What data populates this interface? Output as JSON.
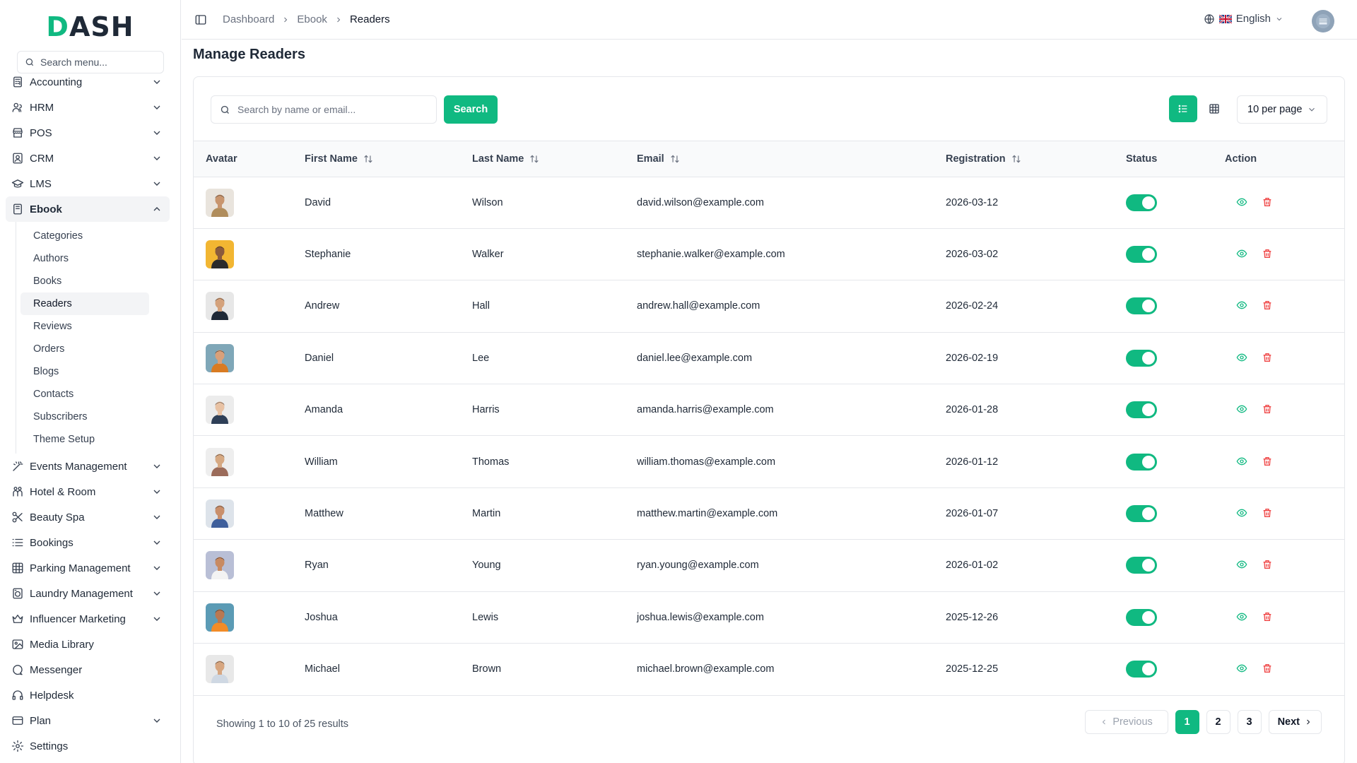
{
  "app": {
    "logo": "DASH"
  },
  "sidebar": {
    "search_placeholder": "Search menu...",
    "items": [
      {
        "label": "Accounting",
        "icon": "calculator-icon",
        "chevron": true
      },
      {
        "label": "HRM",
        "icon": "users-icon",
        "chevron": true
      },
      {
        "label": "POS",
        "icon": "store-icon",
        "chevron": true
      },
      {
        "label": "CRM",
        "icon": "contact-icon",
        "chevron": true
      },
      {
        "label": "LMS",
        "icon": "graduation-cap-icon",
        "chevron": true
      },
      {
        "label": "Ebook",
        "icon": "book-icon",
        "chevron": true,
        "active": true
      }
    ],
    "ebook_sub": [
      "Categories",
      "Authors",
      "Books",
      "Readers",
      "Reviews",
      "Orders",
      "Blogs",
      "Contacts",
      "Subscribers",
      "Theme Setup"
    ],
    "ebook_active": "Readers",
    "items_after": [
      {
        "label": "Events Management",
        "icon": "wand-icon",
        "chevron": true
      },
      {
        "label": "Hotel & Room",
        "icon": "hotel-icon",
        "chevron": true
      },
      {
        "label": "Beauty Spa",
        "icon": "scissors-icon",
        "chevron": true
      },
      {
        "label": "Bookings",
        "icon": "list-icon",
        "chevron": true
      },
      {
        "label": "Parking Management",
        "icon": "grid-icon",
        "chevron": true
      },
      {
        "label": "Laundry Management",
        "icon": "washer-icon",
        "chevron": true
      },
      {
        "label": "Influencer Marketing",
        "icon": "crown-icon",
        "chevron": true
      },
      {
        "label": "Media Library",
        "icon": "image-icon",
        "chevron": false
      },
      {
        "label": "Messenger",
        "icon": "chat-icon",
        "chevron": false
      },
      {
        "label": "Helpdesk",
        "icon": "headset-icon",
        "chevron": false
      },
      {
        "label": "Plan",
        "icon": "card-icon",
        "chevron": true
      },
      {
        "label": "Settings",
        "icon": "gear-icon",
        "chevron": false
      }
    ]
  },
  "topbar": {
    "breadcrumb": [
      "Dashboard",
      "Ebook",
      "Readers"
    ],
    "language": "English"
  },
  "main": {
    "title": "Manage Readers",
    "search_placeholder": "Search by name or email...",
    "search_button": "Search",
    "per_page": "10 per page",
    "columns": [
      "Avatar",
      "First Name",
      "Last Name",
      "Email",
      "Registration",
      "Status",
      "Action"
    ],
    "rows": [
      {
        "first": "David",
        "last": "Wilson",
        "email": "david.wilson@example.com",
        "date": "2026-03-12",
        "active": true,
        "skin": "#c8956e",
        "shirt": "#b08d5c",
        "bg": "#e9e4dd"
      },
      {
        "first": "Stephanie",
        "last": "Walker",
        "email": "stephanie.walker@example.com",
        "date": "2026-03-02",
        "active": true,
        "skin": "#8a5a3c",
        "shirt": "#2b2b2b",
        "bg": "#f2b632"
      },
      {
        "first": "Andrew",
        "last": "Hall",
        "email": "andrew.hall@example.com",
        "date": "2026-02-24",
        "active": true,
        "skin": "#d4a27c",
        "shirt": "#1f2937",
        "bg": "#e7e7e7"
      },
      {
        "first": "Daniel",
        "last": "Lee",
        "email": "daniel.lee@example.com",
        "date": "2026-02-19",
        "active": true,
        "skin": "#d9a07a",
        "shirt": "#d97b22",
        "bg": "#7fa7b8"
      },
      {
        "first": "Amanda",
        "last": "Harris",
        "email": "amanda.harris@example.com",
        "date": "2026-01-28",
        "active": true,
        "skin": "#e8c2a4",
        "shirt": "#2e3f57",
        "bg": "#ececec"
      },
      {
        "first": "William",
        "last": "Thomas",
        "email": "william.thomas@example.com",
        "date": "2026-01-12",
        "active": true,
        "skin": "#d6a983",
        "shirt": "#9b6b5a",
        "bg": "#eeeeee"
      },
      {
        "first": "Matthew",
        "last": "Martin",
        "email": "matthew.martin@example.com",
        "date": "2026-01-07",
        "active": true,
        "skin": "#c98f6b",
        "shirt": "#3f5f9b",
        "bg": "#dde3ea"
      },
      {
        "first": "Ryan",
        "last": "Young",
        "email": "ryan.young@example.com",
        "date": "2026-01-02",
        "active": true,
        "skin": "#c88a62",
        "shirt": "#f3f3f3",
        "bg": "#b9bfd6"
      },
      {
        "first": "Joshua",
        "last": "Lewis",
        "email": "joshua.lewis@example.com",
        "date": "2025-12-26",
        "active": true,
        "skin": "#b97852",
        "shirt": "#f28c28",
        "bg": "#5b9bb5"
      },
      {
        "first": "Michael",
        "last": "Brown",
        "email": "michael.brown@example.com",
        "date": "2025-12-25",
        "active": true,
        "skin": "#d7a680",
        "shirt": "#cfd8e3",
        "bg": "#e8e8e8"
      }
    ],
    "footer": {
      "showing": "Showing 1 to 10 of 25 results",
      "prev": "Previous",
      "next": "Next",
      "pages": [
        "1",
        "2",
        "3"
      ],
      "current_page": "1"
    }
  },
  "colors": {
    "accent": "#10b981",
    "danger": "#ef4444",
    "border": "#e5e7eb"
  }
}
